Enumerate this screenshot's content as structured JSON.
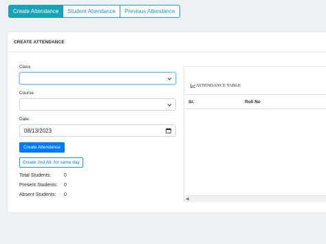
{
  "tabs": [
    {
      "label": "Create Attendance",
      "active": true
    },
    {
      "label": "Student Attendance",
      "active": false
    },
    {
      "label": "Previous Attendance",
      "active": false
    }
  ],
  "card": {
    "title": "CREATE ATTENDANCE"
  },
  "form": {
    "class_label": "Class",
    "class_value": "",
    "course_label": "Course",
    "course_value": "",
    "date_label": "Date:",
    "date_value": "08/13/2023",
    "create_button": "Create Attendance",
    "second_button": "Create 2nd Att. for same day"
  },
  "stats": [
    {
      "label": "Total Students:",
      "value": "0"
    },
    {
      "label": "Present Students:",
      "value": "0"
    },
    {
      "label": "Absent Students:",
      "value": "0"
    }
  ],
  "table": {
    "title": "ATTENDANCE TABLE",
    "columns": [
      "Sr.",
      "Roll No"
    ],
    "rows": []
  },
  "icons": {
    "select_arrow": "chevron-down-icon",
    "date_picker": "calendar-icon",
    "table_title": "table-icon",
    "scroll_left": "scroll-left-icon"
  },
  "colors": {
    "accent": "#17a2b8",
    "primary": "#007bff",
    "background": "#eef1f4"
  }
}
